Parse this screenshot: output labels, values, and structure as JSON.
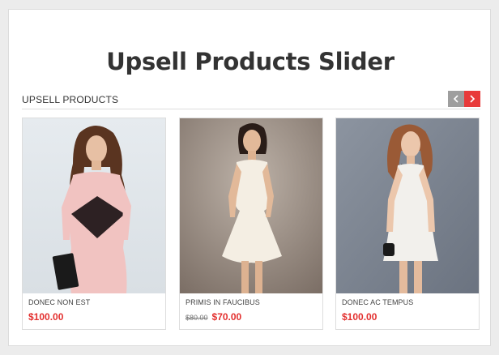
{
  "page": {
    "title": "Upsell Products Slider"
  },
  "section": {
    "title": "UPSELL PRODUCTS",
    "prev_icon": "chevron-left-icon",
    "next_icon": "chevron-right-icon"
  },
  "colors": {
    "accent": "#e83a3a",
    "price": "#e3302f",
    "nav_inactive": "#9e9e9e"
  },
  "products": [
    {
      "name": "DONEC NON EST",
      "old_price": "",
      "price": "$100.00",
      "image": "woman in pink dress with black panel"
    },
    {
      "name": "PRIMIS IN FAUCIBUS",
      "old_price": "$80.00",
      "price": "$70.00",
      "image": "woman in white sleeveless dress"
    },
    {
      "name": "DONEC AC TEMPUS",
      "old_price": "",
      "price": "$100.00",
      "image": "woman in white dress with black collar"
    }
  ]
}
